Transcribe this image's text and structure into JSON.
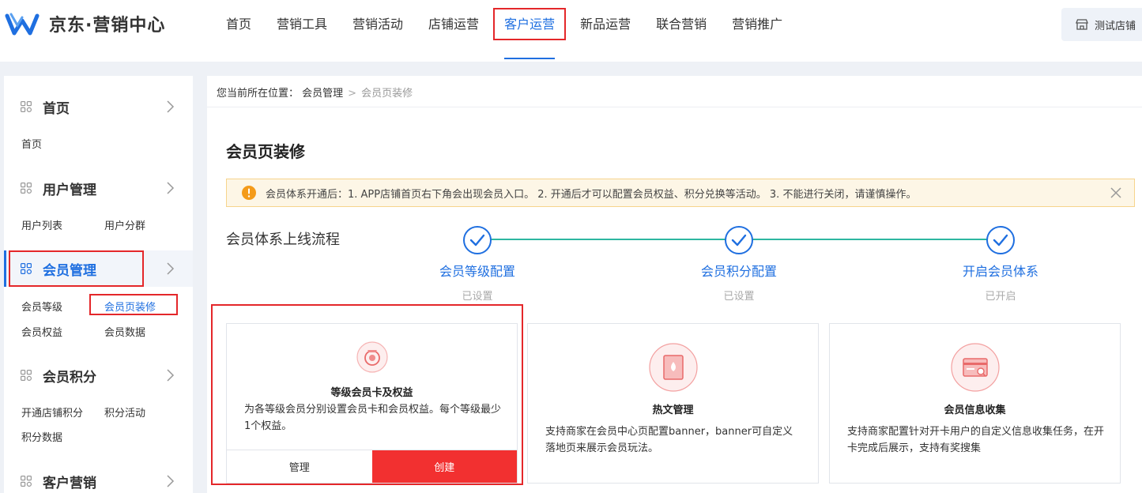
{
  "header": {
    "brand": "京东·营销中心",
    "nav": [
      "首页",
      "营销工具",
      "营销活动",
      "店铺运营",
      "客户运营",
      "新品运营",
      "联合营销",
      "营销推广"
    ],
    "active_nav": "客户运营",
    "store_label": "测试店铺"
  },
  "sidebar": {
    "sections": [
      {
        "title": "首页",
        "links": [
          "首页"
        ]
      },
      {
        "title": "用户管理",
        "links": [
          "用户列表",
          "用户分群"
        ]
      },
      {
        "title": "会员管理",
        "links": [
          "会员等级",
          "会员页装修",
          "会员权益",
          "会员数据"
        ]
      },
      {
        "title": "会员积分",
        "links": [
          "开通店铺积分",
          "积分活动",
          "积分数据"
        ]
      },
      {
        "title": "客户营销",
        "links": []
      }
    ],
    "active_section": "会员管理",
    "active_link": "会员页装修"
  },
  "breadcrumb": {
    "prefix": "您当前所在位置：",
    "parent": "会员管理",
    "current": "会员页装修"
  },
  "page_title": "会员页装修",
  "notice": "会员体系开通后：1. APP店铺首页右下角会出现会员入口。 2. 开通后才可以配置会员权益、积分兑换等活动。 3. 不能进行关闭，请谨慎操作。",
  "flow": {
    "title": "会员体系上线流程",
    "steps": [
      {
        "name": "会员等级配置",
        "status": "已设置"
      },
      {
        "name": "会员积分配置",
        "status": "已设置"
      },
      {
        "name": "开启会员体系",
        "status": "已开启"
      }
    ]
  },
  "cards": [
    {
      "title": "等级会员卡及权益",
      "desc": "为各等级会员分别设置会员卡和会员权益。每个等级最少1个权益。",
      "manage": "管理",
      "create": "创建",
      "icon": "member-card-icon"
    },
    {
      "title": "热文管理",
      "desc": "支持商家在会员中心页配置banner，banner可自定义落地页来展示会员玩法。",
      "icon": "article-icon"
    },
    {
      "title": "会员信息收集",
      "desc": "支持商家配置针对开卡用户的自定义信息收集任务，在开卡完成后展示，支持有奖搜集",
      "icon": "info-collect-icon"
    }
  ],
  "colors": {
    "primary": "#1f6fe0",
    "danger": "#f23030",
    "highlight": "#e4272a",
    "step_line": "#2eb6a0",
    "notice_bg": "#fdf6e6"
  }
}
